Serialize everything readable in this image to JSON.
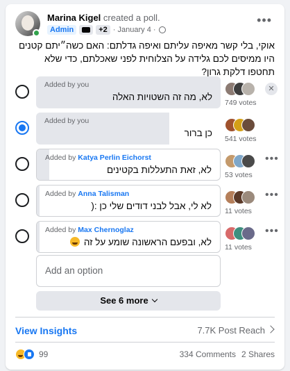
{
  "post": {
    "author": "Marina Kigel",
    "action": "created a poll.",
    "badge_admin": "Admin",
    "badge_plus": "+2",
    "date": "· January 4 ·",
    "icon_privacy": "globe-icon",
    "text": "אוקי, בלי קשר מאיפה עליתם ואיפה גדלתם: האם כשה״יתם קטנים היו ממיסים לכם גלידה על הצלוחית לפני שאכלתם, כדי שלא תחטפו דלקת גרון?"
  },
  "poll": {
    "options": [
      {
        "added_prefix": "Added by",
        "added_by": "you",
        "text": "לא, מה זה השטויות האלה",
        "votes": "749 votes",
        "selected": false,
        "fill_fraction": 1.0,
        "trailing": "x"
      },
      {
        "added_prefix": "Added by",
        "added_by": "you",
        "text": "כן ברור",
        "votes": "541 votes",
        "selected": true,
        "fill_fraction": 0.72,
        "trailing": "none"
      },
      {
        "added_prefix": "Added by",
        "added_by": "Katya Perlin Eichorst",
        "text": "לא, זאת התעללות בקטינים",
        "votes": "53 votes",
        "selected": false,
        "fill_fraction": 0.07,
        "trailing": "more"
      },
      {
        "added_prefix": "Added by",
        "added_by": "Anna Talisman",
        "text": "לא לי, אבל לבני דודים שלי כן :(",
        "votes": "11 votes",
        "selected": false,
        "fill_fraction": 0.015,
        "trailing": "more"
      },
      {
        "added_prefix": "Added by",
        "added_by": "Max Chernoglaz",
        "text": "לא, ובפעם הראשונה שומע על זה",
        "votes": "11 votes",
        "selected": false,
        "fill_fraction": 0.015,
        "trailing": "more",
        "emoji": "smile-emoji"
      }
    ],
    "add_option_placeholder": "Add an option",
    "see_more_label": "See 6 more"
  },
  "insights": {
    "label": "View Insights",
    "reach": "7.7K Post Reach"
  },
  "footer": {
    "reactions_count": "99",
    "comments": "334 Comments",
    "shares": "2 Shares"
  },
  "colors": {
    "accent": "#1877f2",
    "fill": "#e4e6eb",
    "secondary_text": "#65676b"
  }
}
